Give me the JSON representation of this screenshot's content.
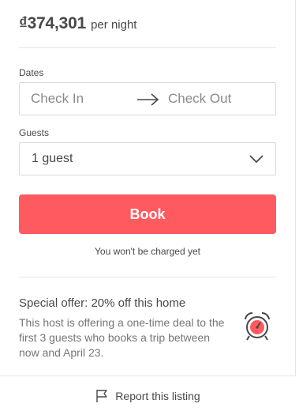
{
  "booking": {
    "price": "₫374,301",
    "price_unit": "per night",
    "dates_label": "Dates",
    "check_in_placeholder": "Check In",
    "check_out_placeholder": "Check Out",
    "guests_label": "Guests",
    "guests_value": "1 guest",
    "book_label": "Book",
    "charge_note": "You won't be charged yet"
  },
  "offer": {
    "title": "Special offer: 20% off this home",
    "body": "This host is offering a one-time deal to the first 3 guests who books a trip between now and April 23.",
    "icon": "alarm-clock-icon"
  },
  "footer": {
    "report_label": "Report this listing",
    "icon": "flag-icon"
  },
  "colors": {
    "accent": "#ff5a5f",
    "text": "#484848",
    "muted": "#767676",
    "border": "#dbdbdb"
  }
}
